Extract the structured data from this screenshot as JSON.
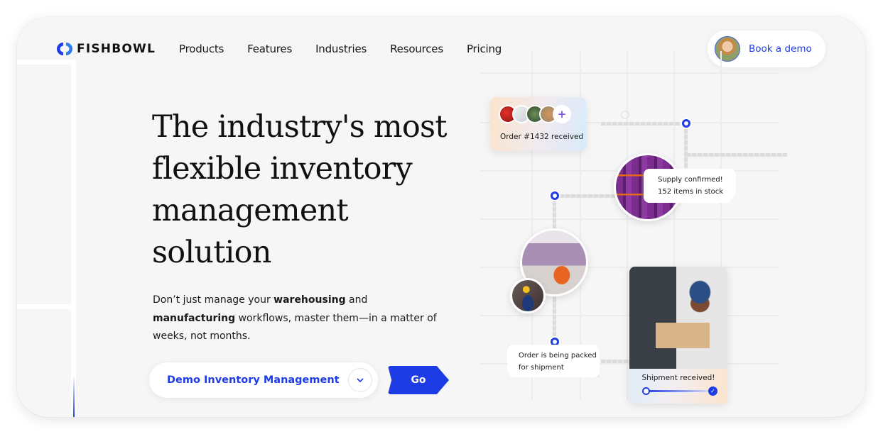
{
  "brand": {
    "name": "FISHBOWL",
    "accent_color": "#1d3ce6"
  },
  "nav": {
    "items": [
      {
        "label": "Products"
      },
      {
        "label": "Features"
      },
      {
        "label": "Industries"
      },
      {
        "label": "Resources"
      },
      {
        "label": "Pricing"
      }
    ],
    "cta": {
      "label": "Book a demo",
      "avatar": "sales-rep-avatar"
    }
  },
  "hero": {
    "headline": "The industry's most flexible inventory management solution",
    "subtext": {
      "part1": "Don’t just manage your ",
      "bold1": "warehousing",
      "part2": " and ",
      "bold2": "manufacturing",
      "part3": " workflows, master them—in a matter of weeks, not months."
    },
    "demo_select": {
      "selected": "Demo Inventory Management",
      "chevron_icon": "chevron-down-icon"
    },
    "go_button": "Go"
  },
  "illustration": {
    "order_card": {
      "text": "Order #1432 received",
      "plus_icon": "+"
    },
    "supply_card": {
      "line1": "Supply confirmed!",
      "line2": "152 items in stock"
    },
    "packed_card": {
      "line1": "Order is being packed",
      "line2": "for shipment"
    },
    "shipment_card": {
      "title": "Shipment received!",
      "progress": 1.0,
      "check_icon": "✓"
    }
  }
}
